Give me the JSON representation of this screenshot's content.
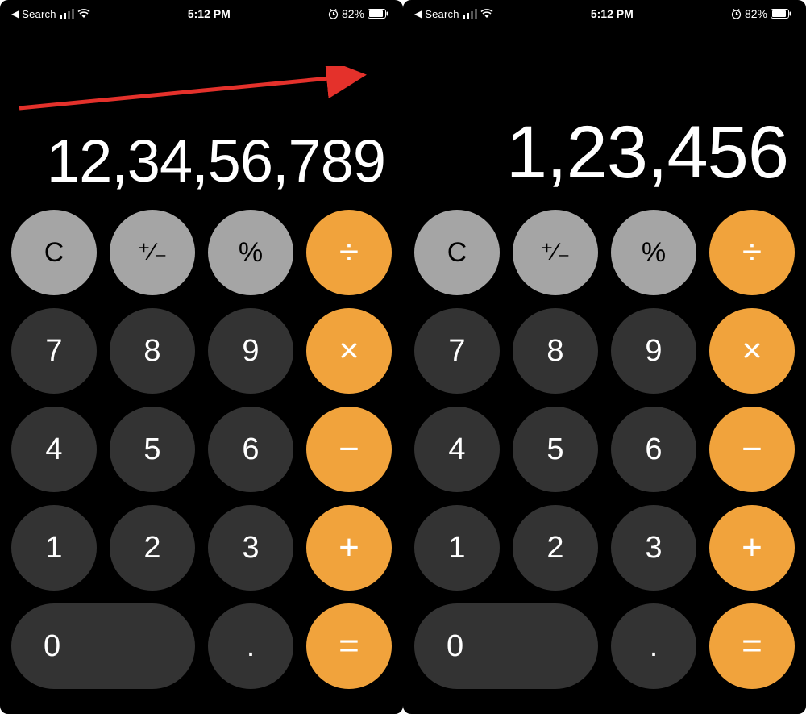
{
  "status": {
    "back_label": "Search",
    "time": "5:12 PM",
    "battery_pct": "82%"
  },
  "screens": [
    {
      "display": "12,34,56,789",
      "show_arrow": true
    },
    {
      "display": "1,23,456",
      "show_arrow": false
    }
  ],
  "buttons": {
    "clear": "C",
    "sign": "+/-",
    "percent": "%",
    "divide": "÷",
    "n7": "7",
    "n8": "8",
    "n9": "9",
    "multiply": "×",
    "n4": "4",
    "n5": "5",
    "n6": "6",
    "minus": "−",
    "n1": "1",
    "n2": "2",
    "n3": "3",
    "plus": "+",
    "n0": "0",
    "decimal": ".",
    "equals": "="
  },
  "colors": {
    "operator": "#f1a33c",
    "light": "#a5a5a5",
    "dark": "#333333",
    "arrow": "#e4312b"
  }
}
